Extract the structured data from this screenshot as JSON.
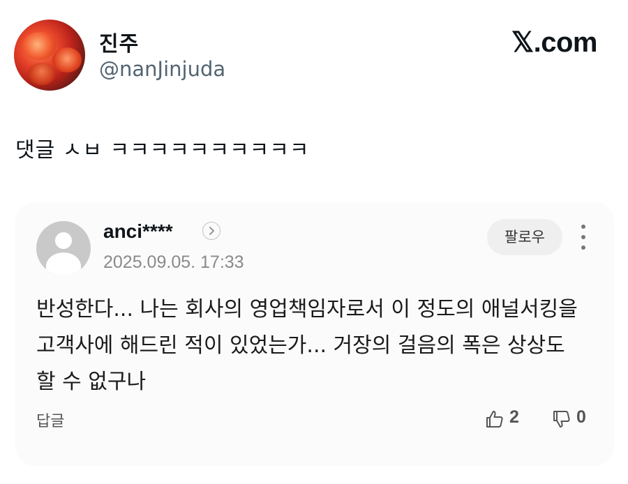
{
  "author": {
    "display_name": "진주",
    "handle": "@nanJinjuda"
  },
  "brand": "𝕏.com",
  "tweet_text": "댓글 ㅅㅂ ㅋㅋㅋㅋㅋㅋㅋㅋㅋㅋ",
  "comment": {
    "username": "anci****",
    "profile_link_icon": "chevron-right",
    "date": "2025.09.05. 17:33",
    "follow_label": "팔로우",
    "more_icon": "vertical-dots",
    "body": "반성한다... 나는 회사의 영업책임자로서 이 정도의 애널서킹을 고객사에 해드린 적이 있었는가... 거장의 걸음의 폭은 상상도 할 수 없구나",
    "reply_label": "답글",
    "likes": "2",
    "dislikes": "0"
  },
  "colors": {
    "background": "#ffffff",
    "card": "#fbfbfb",
    "handle": "#536471",
    "muted": "#8a8a8a",
    "follow_bg": "#efefef"
  }
}
